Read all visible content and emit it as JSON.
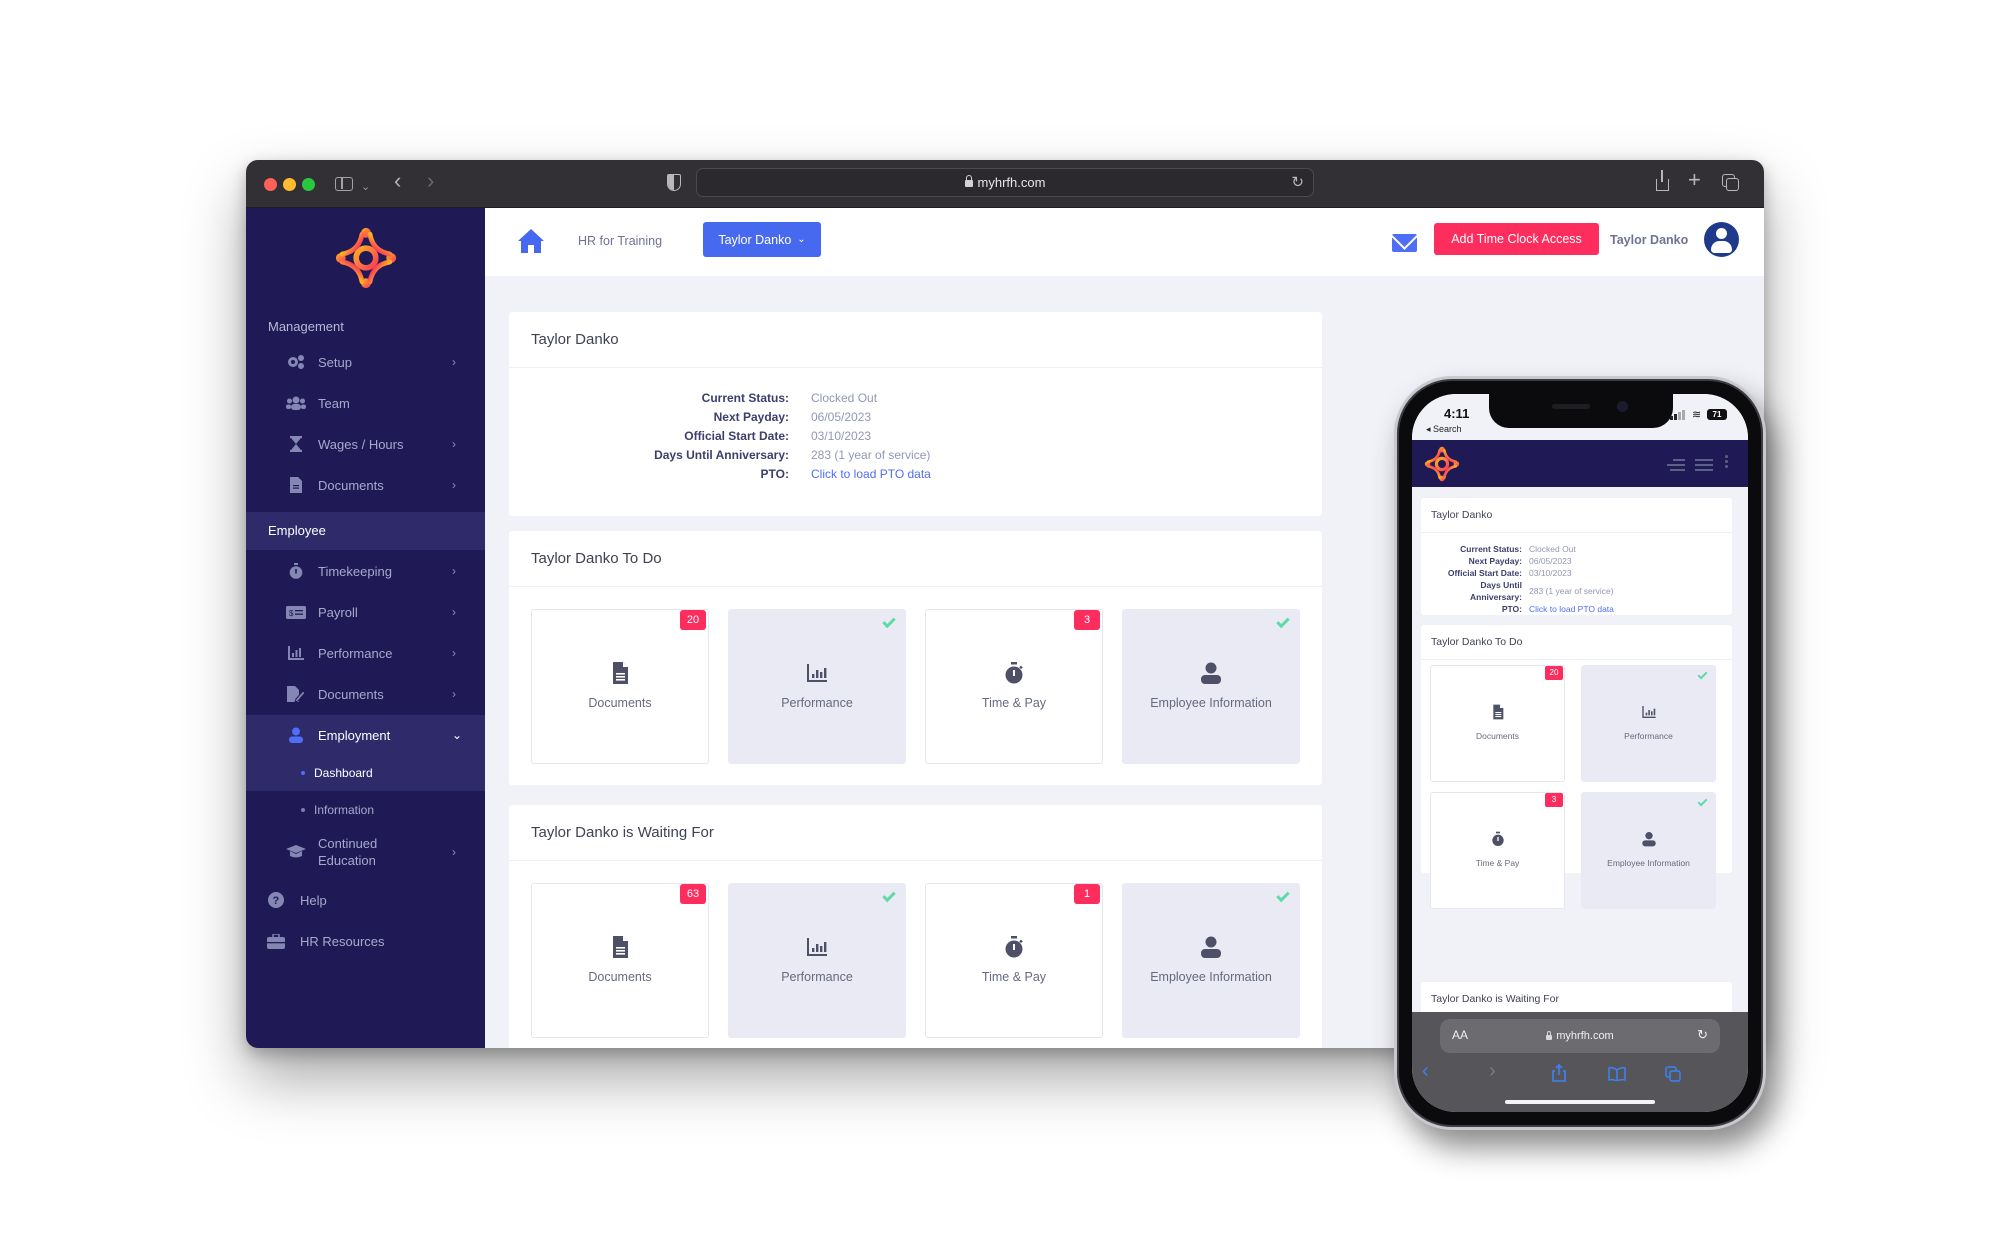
{
  "browser": {
    "url": "myhrfh.com",
    "nav": {
      "back": "‹",
      "forward": "›",
      "new_tab": "+",
      "reload": "↻",
      "menu_chevron": "⌄"
    }
  },
  "colors": {
    "sidebar_bg": "#1f1a55",
    "sidebar_active": "#2f2b6b",
    "primary": "#4669ef",
    "danger": "#fd2d5e",
    "success_check": "#5fdba7",
    "link": "#4f6ef7"
  },
  "sidebar": {
    "sections": [
      {
        "label": "Management"
      },
      {
        "label": "Employee"
      }
    ],
    "management_items": [
      {
        "label": "Setup",
        "icon": "gears-icon",
        "has_chevron": true
      },
      {
        "label": "Team",
        "icon": "users-icon",
        "has_chevron": false
      },
      {
        "label": "Wages / Hours",
        "icon": "hourglass-icon",
        "has_chevron": true
      },
      {
        "label": "Documents",
        "icon": "file-icon",
        "has_chevron": true
      }
    ],
    "employee_items": [
      {
        "label": "Timekeeping",
        "icon": "stopwatch-icon",
        "has_chevron": true
      },
      {
        "label": "Payroll",
        "icon": "money-check-icon",
        "has_chevron": true
      },
      {
        "label": "Performance",
        "icon": "bar-chart-icon",
        "has_chevron": true
      },
      {
        "label": "Documents",
        "icon": "file-signature-icon",
        "has_chevron": true
      },
      {
        "label": "Employment",
        "icon": "user-icon",
        "expanded": true,
        "chevron": "⌄"
      }
    ],
    "employment_sub": [
      {
        "label": "Dashboard",
        "active": true
      },
      {
        "label": "Information",
        "active": false
      }
    ],
    "continued_education": {
      "label_line1": "Continued",
      "label_line2": "Education",
      "icon": "graduation-cap-icon"
    },
    "bottom_items": [
      {
        "label": "Help",
        "icon": "question-circle-icon"
      },
      {
        "label": "HR Resources",
        "icon": "toolbox-icon"
      }
    ],
    "chevron": "›"
  },
  "topnav": {
    "breadcrumb": "HR for Training",
    "user_select": "Taylor Danko",
    "user_select_caret": "⌄",
    "add_button": "Add Time Clock Access",
    "user_name": "Taylor Danko"
  },
  "profile_card": {
    "title": "Taylor Danko",
    "rows": [
      {
        "label": "Current Status:",
        "value": "Clocked Out"
      },
      {
        "label": "Next Payday:",
        "value": "06/05/2023"
      },
      {
        "label": "Official Start Date:",
        "value": "03/10/2023"
      },
      {
        "label": "Days Until Anniversary:",
        "value": "283 (1 year of service)"
      },
      {
        "label": "PTO:",
        "value": "Click to load PTO data",
        "link": true
      }
    ],
    "mobile_anniversary_label_line1": "Days Until",
    "mobile_anniversary_label_line2": "Anniversary:"
  },
  "todo_card": {
    "title": "Taylor Danko To Do",
    "tiles": [
      {
        "label": "Documents",
        "icon": "file-icon",
        "badge": "20",
        "done": false
      },
      {
        "label": "Performance",
        "icon": "bar-chart-icon",
        "badge": null,
        "done": true
      },
      {
        "label": "Time & Pay",
        "icon": "stopwatch-icon",
        "badge": "3",
        "done": false
      },
      {
        "label": "Employee Information",
        "icon": "user-icon",
        "badge": null,
        "done": true
      }
    ]
  },
  "waiting_card": {
    "title": "Taylor Danko is Waiting For",
    "tiles": [
      {
        "label": "Documents",
        "icon": "file-icon",
        "badge": "63",
        "done": false
      },
      {
        "label": "Performance",
        "icon": "bar-chart-icon",
        "badge": null,
        "done": true
      },
      {
        "label": "Time & Pay",
        "icon": "stopwatch-icon",
        "badge": "1",
        "done": false
      },
      {
        "label": "Employee Information",
        "icon": "user-icon",
        "badge": null,
        "done": true
      }
    ]
  },
  "phone": {
    "time": "4:11",
    "back_label": "◂ Search",
    "battery": "71",
    "wifi": "≋",
    "safari": {
      "text_size": "AA",
      "url": "myhrfh.com",
      "reload": "↻",
      "back": "‹",
      "forward": "›"
    }
  }
}
